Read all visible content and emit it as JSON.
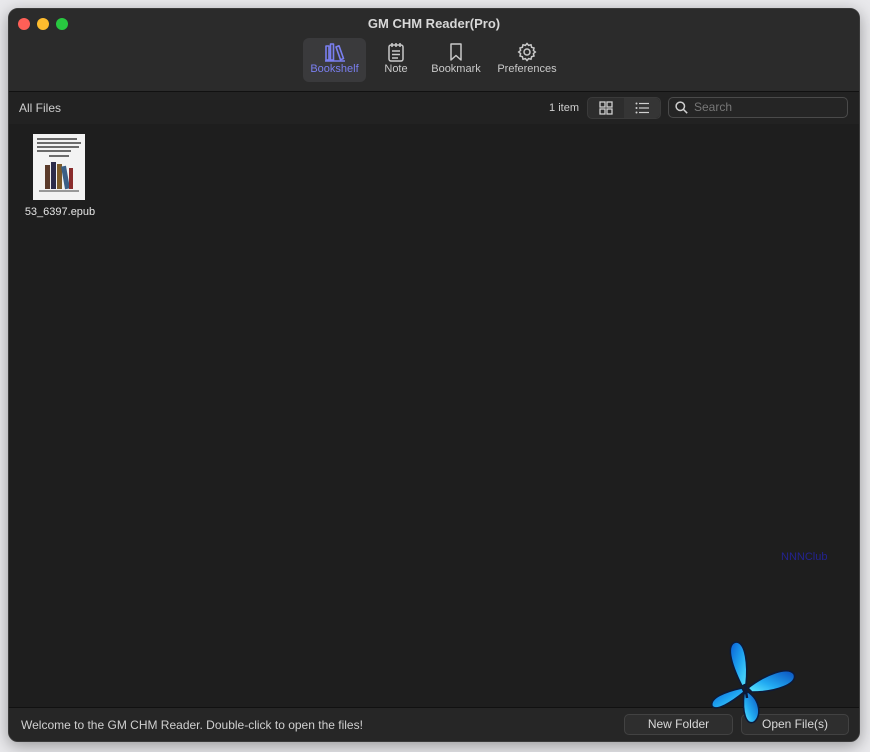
{
  "window": {
    "title": "GM CHM Reader(Pro)"
  },
  "toolbar": {
    "items": [
      {
        "label": "Bookshelf",
        "icon": "bookshelf-icon",
        "active": true
      },
      {
        "label": "Note",
        "icon": "note-icon",
        "active": false
      },
      {
        "label": "Bookmark",
        "icon": "bookmark-icon",
        "active": false
      },
      {
        "label": "Preferences",
        "icon": "gear-icon",
        "active": false
      }
    ]
  },
  "subbar": {
    "section_title": "All Files",
    "item_count": "1 item",
    "view_modes": [
      "grid-view-icon",
      "list-view-icon"
    ],
    "search_placeholder": "Search"
  },
  "files": [
    {
      "name": "53_6397.epub"
    }
  ],
  "watermark": "NNNClub",
  "statusbar": {
    "message": "Welcome to the GM CHM Reader. Double-click to open the files!",
    "new_folder_label": "New Folder",
    "open_files_label": "Open File(s)"
  },
  "colors": {
    "accent": "#7a7ff0",
    "background": "#1e1e1e",
    "close": "#ff5f57",
    "minimize": "#febc2e",
    "zoom": "#28c840"
  }
}
